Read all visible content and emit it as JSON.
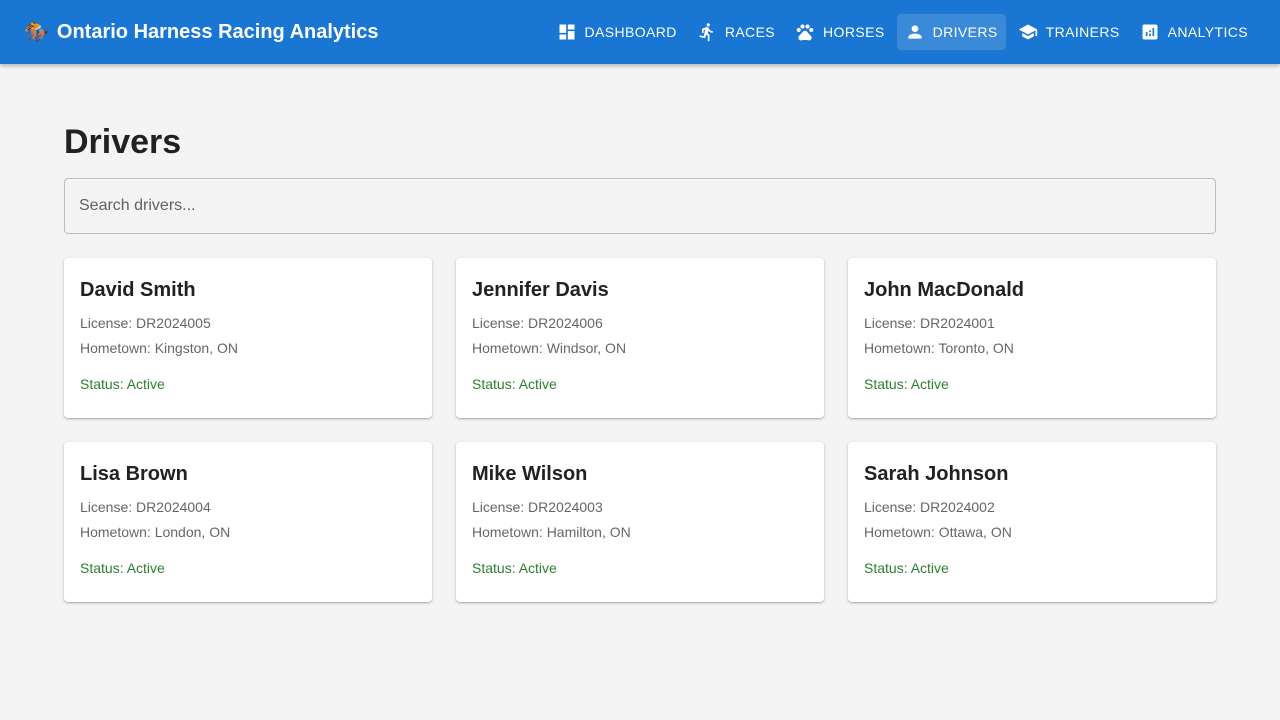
{
  "app": {
    "title": "Ontario Harness Racing Analytics",
    "logo_icon": "🏇"
  },
  "nav": {
    "items": [
      {
        "label": "DASHBOARD",
        "icon": "dashboard-icon"
      },
      {
        "label": "RACES",
        "icon": "run-icon"
      },
      {
        "label": "HORSES",
        "icon": "paw-icon"
      },
      {
        "label": "DRIVERS",
        "icon": "person-icon",
        "active": true
      },
      {
        "label": "TRAINERS",
        "icon": "school-icon"
      },
      {
        "label": "ANALYTICS",
        "icon": "analytics-icon"
      }
    ]
  },
  "page": {
    "title": "Drivers",
    "search_placeholder": "Search drivers...",
    "search_value": ""
  },
  "drivers": [
    {
      "name": "David Smith",
      "license": "License: DR2024005",
      "hometown": "Hometown: Kingston, ON",
      "status": "Status: Active"
    },
    {
      "name": "Jennifer Davis",
      "license": "License: DR2024006",
      "hometown": "Hometown: Windsor, ON",
      "status": "Status: Active"
    },
    {
      "name": "John MacDonald",
      "license": "License: DR2024001",
      "hometown": "Hometown: Toronto, ON",
      "status": "Status: Active"
    },
    {
      "name": "Lisa Brown",
      "license": "License: DR2024004",
      "hometown": "Hometown: London, ON",
      "status": "Status: Active"
    },
    {
      "name": "Mike Wilson",
      "license": "License: DR2024003",
      "hometown": "Hometown: Hamilton, ON",
      "status": "Status: Active"
    },
    {
      "name": "Sarah Johnson",
      "license": "License: DR2024002",
      "hometown": "Hometown: Ottawa, ON",
      "status": "Status: Active"
    }
  ],
  "colors": {
    "appbar": "#1976d2",
    "status_active": "#2e7d32",
    "background": "#f4f4f4"
  }
}
